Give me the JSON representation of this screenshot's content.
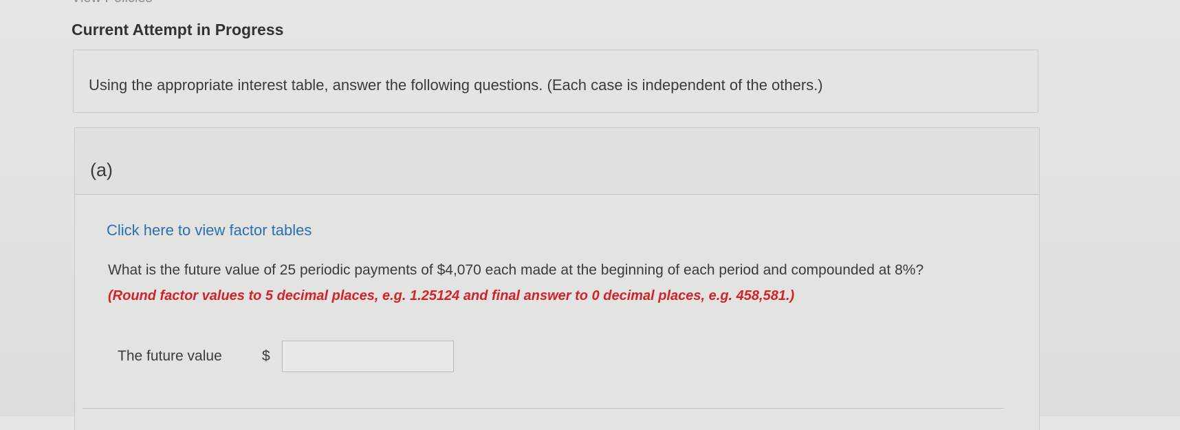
{
  "header": {
    "policies_link": "View Policies",
    "title": "Current Attempt in Progress"
  },
  "instructions": {
    "text": "Using the appropriate interest table, answer the following questions. (Each case is independent of the others.)"
  },
  "part_a": {
    "label": "(a)",
    "factor_tables_link": "Click here to view factor tables",
    "question": "What is the future value of 25 periodic payments of $4,070 each made at the beginning of each period and compounded at 8%?",
    "rounding_note": "(Round factor values to 5 decimal places, e.g. 1.25124 and final answer to 0 decimal places, e.g. 458,581.)",
    "answer_label": "The future value",
    "currency_symbol": "$",
    "answer_value": ""
  },
  "colors": {
    "link": "#2c6fb1",
    "warning": "#d2232a",
    "text": "#3b3b3b"
  }
}
